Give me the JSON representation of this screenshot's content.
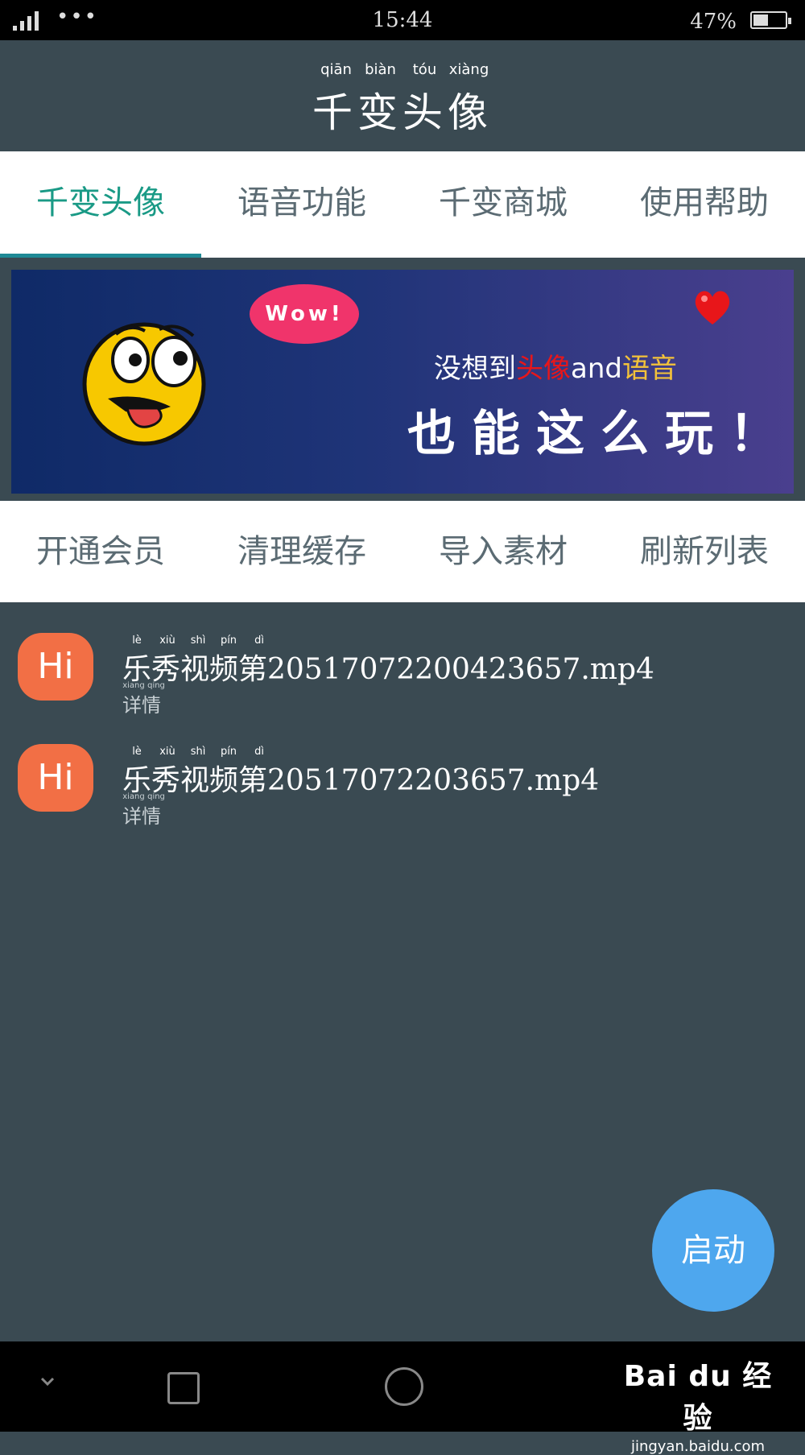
{
  "status_bar": {
    "time": "15:44",
    "battery": "47%",
    "battery_level": 0.47
  },
  "header": {
    "pinyin": [
      "qiān",
      "biàn",
      "tóu",
      "xiàng"
    ],
    "title": "千变头像"
  },
  "tabs": [
    {
      "label": "千变头像",
      "active": true
    },
    {
      "label": "语音功能",
      "active": false
    },
    {
      "label": "千变商城",
      "active": false
    },
    {
      "label": "使用帮助",
      "active": false
    }
  ],
  "banner": {
    "bubble": "Wow!",
    "line1_part1": "没想到",
    "line1_part2": "头像",
    "line1_part3": "and",
    "line1_part4": "语音",
    "line2": "也能这么玩！"
  },
  "actions": [
    {
      "label": "开通会员"
    },
    {
      "label": "清理缓存"
    },
    {
      "label": "导入素材"
    },
    {
      "label": "刷新列表"
    }
  ],
  "list": [
    {
      "avatar_text": "Hi",
      "name_pinyin": [
        "lè",
        "xiù",
        "shì",
        "pín",
        "dì"
      ],
      "name": "乐秀视频第20517072200423657.mp4",
      "detail_pinyin": [
        "xiang",
        "qing"
      ],
      "detail": "详情"
    },
    {
      "avatar_text": "Hi",
      "name_pinyin": [
        "lè",
        "xiù",
        "shì",
        "pín",
        "dì"
      ],
      "name": "乐秀视频第20517072203657.mp4",
      "detail_pinyin": [
        "xiang",
        "qing"
      ],
      "detail": "详情"
    }
  ],
  "fab": {
    "label": "启动"
  },
  "watermark": {
    "brand": "Bai du 经验",
    "url": "jingyan.baidu.com"
  },
  "colors": {
    "accent": "#1a9a86",
    "background": "#3a4a52",
    "fab": "#4ea7ee",
    "avatar": "#f26f45"
  }
}
